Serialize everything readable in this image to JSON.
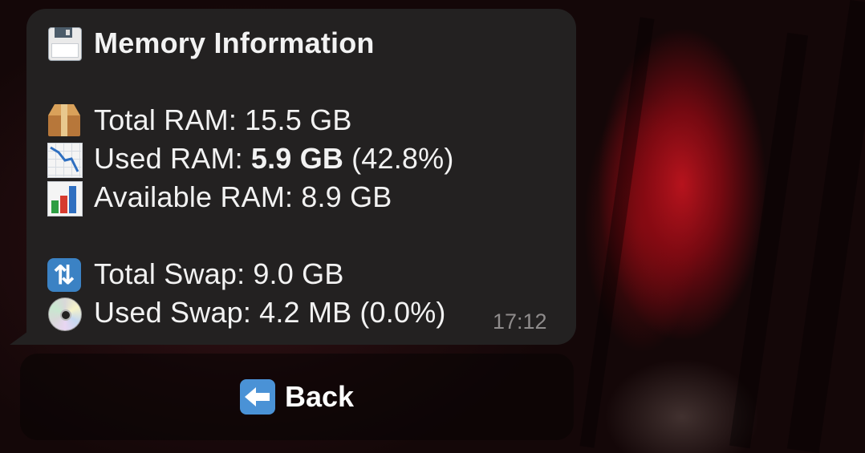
{
  "message": {
    "title": "Memory Information",
    "title_icon": "floppy-disk-icon",
    "ram": {
      "total_label": "Total RAM: ",
      "total_value": "15.5 GB",
      "total_icon": "package-icon",
      "used_label": "Used RAM: ",
      "used_value": "5.9 GB",
      "used_percent": " (42.8%)",
      "used_icon": "chart-decreasing-icon",
      "available_label": "Available RAM: ",
      "available_value": "8.9 GB",
      "available_icon": "bar-chart-icon"
    },
    "swap": {
      "total_label": "Total Swap: ",
      "total_value": "9.0 GB",
      "total_icon": "swap-arrows-icon",
      "used_label": "Used Swap: ",
      "used_value": "4.2 MB",
      "used_percent": " (0.0%)",
      "used_icon": "dvd-icon"
    },
    "timestamp": "17:12"
  },
  "keyboard": {
    "back_label": "Back",
    "back_icon": "back-arrow-icon"
  },
  "colors": {
    "bubble": "#232121",
    "text": "#f2f2f2",
    "timestamp": "#8f8c8c",
    "button_icon": "#4a92d6"
  }
}
